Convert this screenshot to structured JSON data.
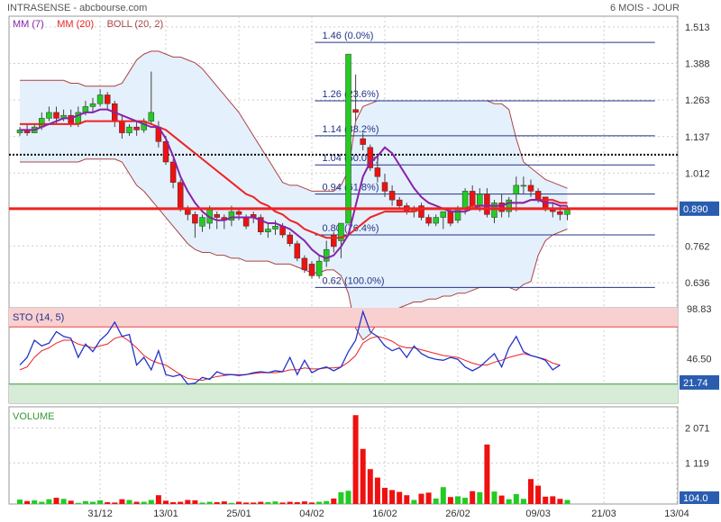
{
  "header": {
    "title": "INTRASENSE - abcbourse.com",
    "period": "6 MOIS - JOUR"
  },
  "colors": {
    "up": "#22cc22",
    "down": "#ee1111",
    "mm7": "#8822aa",
    "mm20": "#ee2222",
    "boll": "#aa4444",
    "boll_fill": "#e4f0fb",
    "fibo": "#223388",
    "sto_fast": "#2233cc",
    "sto_slow": "#ee2222",
    "price_tag": "#2a5db0"
  },
  "chart_data": [
    {
      "type": "candlestick",
      "title": "INTRASENSE",
      "legend": [
        {
          "label": "MM (7)",
          "color": "#8822aa"
        },
        {
          "label": "MM (20)",
          "color": "#ee2222"
        },
        {
          "label": "BOLL (20, 2)",
          "color": "#aa4444"
        }
      ],
      "x_labels": [
        "31/12",
        "13/01",
        "25/01",
        "04/02",
        "16/02",
        "26/02",
        "09/03",
        "21/03",
        "13/04"
      ],
      "x_label_index": [
        11,
        20,
        30,
        40,
        50,
        60,
        71,
        80,
        90
      ],
      "y_ticks": [
        1.513,
        1.388,
        1.263,
        1.137,
        1.012,
        0.762,
        0.636
      ],
      "ylim": [
        0.55,
        1.55
      ],
      "last_price": "0.890",
      "dotted_level": 1.075,
      "fibonacci": [
        {
          "label": "1.46  (0.0%)",
          "value": 1.46
        },
        {
          "label": "1.26  (23.6%)",
          "value": 1.26
        },
        {
          "label": "1.14  (38.2%)",
          "value": 1.14
        },
        {
          "label": "1.04  (50.0%)",
          "value": 1.04
        },
        {
          "label": "0.94  (61.8%)",
          "value": 0.94
        },
        {
          "label": "0.80  (76.4%)",
          "value": 0.8
        },
        {
          "label": "0.62  (100.0%)",
          "value": 0.62
        }
      ],
      "candles": [
        [
          1.15,
          1.17,
          1.14,
          1.16
        ],
        [
          1.16,
          1.18,
          1.14,
          1.15
        ],
        [
          1.15,
          1.18,
          1.15,
          1.17
        ],
        [
          1.17,
          1.22,
          1.16,
          1.2
        ],
        [
          1.2,
          1.24,
          1.19,
          1.22
        ],
        [
          1.22,
          1.24,
          1.18,
          1.2
        ],
        [
          1.2,
          1.23,
          1.19,
          1.21
        ],
        [
          1.21,
          1.23,
          1.17,
          1.18
        ],
        [
          1.18,
          1.24,
          1.17,
          1.22
        ],
        [
          1.22,
          1.26,
          1.21,
          1.24
        ],
        [
          1.24,
          1.27,
          1.22,
          1.25
        ],
        [
          1.25,
          1.3,
          1.24,
          1.28
        ],
        [
          1.28,
          1.29,
          1.23,
          1.25
        ],
        [
          1.25,
          1.26,
          1.17,
          1.19
        ],
        [
          1.19,
          1.21,
          1.13,
          1.15
        ],
        [
          1.15,
          1.18,
          1.14,
          1.17
        ],
        [
          1.17,
          1.19,
          1.14,
          1.16
        ],
        [
          1.16,
          1.2,
          1.15,
          1.19
        ],
        [
          1.19,
          1.36,
          1.18,
          1.22
        ],
        [
          1.17,
          1.19,
          1.1,
          1.12
        ],
        [
          1.12,
          1.14,
          1.04,
          1.05
        ],
        [
          1.05,
          1.06,
          0.96,
          0.98
        ],
        [
          0.98,
          0.99,
          0.88,
          0.89
        ],
        [
          0.89,
          0.9,
          0.85,
          0.87
        ],
        [
          0.87,
          0.88,
          0.79,
          0.84
        ],
        [
          0.83,
          0.87,
          0.81,
          0.86
        ],
        [
          0.84,
          0.9,
          0.82,
          0.89
        ],
        [
          0.87,
          0.88,
          0.82,
          0.86
        ],
        [
          0.86,
          0.87,
          0.82,
          0.85
        ],
        [
          0.85,
          0.9,
          0.83,
          0.88
        ],
        [
          0.88,
          0.89,
          0.85,
          0.87
        ],
        [
          0.86,
          0.87,
          0.82,
          0.83
        ],
        [
          0.87,
          0.88,
          0.84,
          0.86
        ],
        [
          0.86,
          0.87,
          0.8,
          0.81
        ],
        [
          0.81,
          0.84,
          0.79,
          0.82
        ],
        [
          0.82,
          0.85,
          0.8,
          0.83
        ],
        [
          0.83,
          0.84,
          0.79,
          0.8
        ],
        [
          0.8,
          0.81,
          0.76,
          0.77
        ],
        [
          0.77,
          0.78,
          0.71,
          0.72
        ],
        [
          0.72,
          0.73,
          0.67,
          0.68
        ],
        [
          0.7,
          0.71,
          0.65,
          0.66
        ],
        [
          0.66,
          0.73,
          0.65,
          0.71
        ],
        [
          0.71,
          0.78,
          0.69,
          0.75
        ],
        [
          0.8,
          0.81,
          0.74,
          0.76
        ],
        [
          0.78,
          0.84,
          0.72,
          0.84
        ],
        [
          0.84,
          1.42,
          0.84,
          1.42
        ],
        [
          1.23,
          1.35,
          1.19,
          1.22
        ],
        [
          1.13,
          1.15,
          1.09,
          1.11
        ],
        [
          1.1,
          1.11,
          1.02,
          1.03
        ],
        [
          1.03,
          1.07,
          0.98,
          1.0
        ],
        [
          0.98,
          1.01,
          0.93,
          0.95
        ],
        [
          0.95,
          0.97,
          0.9,
          0.92
        ],
        [
          0.92,
          0.93,
          0.89,
          0.9
        ],
        [
          0.9,
          0.91,
          0.87,
          0.88
        ],
        [
          0.88,
          0.9,
          0.86,
          0.89
        ],
        [
          0.9,
          0.91,
          0.85,
          0.86
        ],
        [
          0.86,
          0.87,
          0.83,
          0.84
        ],
        [
          0.84,
          0.87,
          0.83,
          0.86
        ],
        [
          0.86,
          0.88,
          0.82,
          0.88
        ],
        [
          0.88,
          0.89,
          0.83,
          0.84
        ],
        [
          0.85,
          0.9,
          0.84,
          0.89
        ],
        [
          0.89,
          0.96,
          0.87,
          0.95
        ],
        [
          0.95,
          0.97,
          0.89,
          0.9
        ],
        [
          0.9,
          0.96,
          0.88,
          0.94
        ],
        [
          0.94,
          0.96,
          0.86,
          0.87
        ],
        [
          0.86,
          0.92,
          0.84,
          0.91
        ],
        [
          0.91,
          0.94,
          0.86,
          0.88
        ],
        [
          0.88,
          0.93,
          0.86,
          0.92
        ],
        [
          0.94,
          1.0,
          0.88,
          0.97
        ],
        [
          0.97,
          1.0,
          0.94,
          0.97
        ],
        [
          0.97,
          0.99,
          0.93,
          0.95
        ],
        [
          0.95,
          0.96,
          0.91,
          0.92
        ],
        [
          0.93,
          0.93,
          0.88,
          0.89
        ],
        [
          0.89,
          0.91,
          0.86,
          0.88
        ],
        [
          0.88,
          0.9,
          0.85,
          0.87
        ],
        [
          0.87,
          0.9,
          0.85,
          0.89
        ]
      ],
      "mm7": [
        1.16,
        1.16,
        1.16,
        1.17,
        1.18,
        1.19,
        1.2,
        1.2,
        1.21,
        1.22,
        1.22,
        1.23,
        1.23,
        1.22,
        1.21,
        1.2,
        1.19,
        1.18,
        1.17,
        1.17,
        1.13,
        1.07,
        1.0,
        0.95,
        0.91,
        0.88,
        0.86,
        0.85,
        0.85,
        0.86,
        0.86,
        0.86,
        0.86,
        0.85,
        0.84,
        0.84,
        0.83,
        0.82,
        0.8,
        0.78,
        0.75,
        0.73,
        0.72,
        0.73,
        0.76,
        0.8,
        0.9,
        1.0,
        1.05,
        1.07,
        1.1,
        1.08,
        1.04,
        1.0,
        0.96,
        0.93,
        0.91,
        0.9,
        0.89,
        0.88,
        0.88,
        0.88,
        0.89,
        0.9,
        0.9,
        0.9,
        0.9,
        0.91,
        0.91,
        0.91,
        0.92,
        0.92,
        0.91,
        0.91,
        0.9,
        0.9
      ],
      "mm20": [
        1.18,
        1.18,
        1.18,
        1.18,
        1.18,
        1.18,
        1.18,
        1.18,
        1.18,
        1.19,
        1.19,
        1.19,
        1.19,
        1.19,
        1.19,
        1.19,
        1.19,
        1.19,
        1.18,
        1.17,
        1.16,
        1.14,
        1.12,
        1.1,
        1.08,
        1.06,
        1.04,
        1.02,
        1.0,
        0.98,
        0.96,
        0.94,
        0.93,
        0.91,
        0.9,
        0.88,
        0.87,
        0.85,
        0.84,
        0.82,
        0.81,
        0.8,
        0.79,
        0.79,
        0.79,
        0.8,
        0.82,
        0.84,
        0.86,
        0.87,
        0.88,
        0.88,
        0.88,
        0.88,
        0.88,
        0.89,
        0.89,
        0.89,
        0.89,
        0.89,
        0.89,
        0.89,
        0.9,
        0.9,
        0.9,
        0.9,
        0.9,
        0.91,
        0.91,
        0.91,
        0.92,
        0.92,
        0.92,
        0.92,
        0.91,
        0.91
      ],
      "boll_upper": [
        1.33,
        1.33,
        1.33,
        1.33,
        1.33,
        1.33,
        1.33,
        1.32,
        1.32,
        1.31,
        1.31,
        1.31,
        1.31,
        1.31,
        1.32,
        1.36,
        1.4,
        1.42,
        1.43,
        1.43,
        1.42,
        1.41,
        1.41,
        1.4,
        1.39,
        1.37,
        1.34,
        1.31,
        1.28,
        1.25,
        1.22,
        1.18,
        1.14,
        1.1,
        1.06,
        1.02,
        0.98,
        0.97,
        0.97,
        0.96,
        0.95,
        0.95,
        0.95,
        0.95,
        0.97,
        1.02,
        1.19,
        1.24,
        1.25,
        1.26,
        1.26,
        1.26,
        1.26,
        1.26,
        1.26,
        1.26,
        1.26,
        1.26,
        1.26,
        1.26,
        1.26,
        1.26,
        1.26,
        1.26,
        1.26,
        1.25,
        1.25,
        1.23,
        1.13,
        1.05,
        1.03,
        1.01,
        0.99,
        0.98,
        0.97,
        0.96
      ],
      "boll_lower": [
        1.05,
        1.05,
        1.05,
        1.05,
        1.05,
        1.05,
        1.05,
        1.05,
        1.05,
        1.06,
        1.06,
        1.06,
        1.06,
        1.06,
        1.05,
        1.01,
        0.97,
        0.95,
        0.92,
        0.89,
        0.86,
        0.83,
        0.8,
        0.77,
        0.75,
        0.74,
        0.74,
        0.73,
        0.73,
        0.72,
        0.72,
        0.71,
        0.71,
        0.71,
        0.71,
        0.7,
        0.7,
        0.7,
        0.69,
        0.68,
        0.67,
        0.67,
        0.68,
        0.68,
        0.66,
        0.6,
        0.48,
        0.44,
        0.46,
        0.5,
        0.52,
        0.54,
        0.55,
        0.56,
        0.57,
        0.57,
        0.58,
        0.58,
        0.59,
        0.59,
        0.6,
        0.6,
        0.61,
        0.62,
        0.62,
        0.62,
        0.62,
        0.62,
        0.61,
        0.63,
        0.64,
        0.73,
        0.78,
        0.8,
        0.81,
        0.82
      ]
    },
    {
      "type": "line",
      "title": "STO (14, 5)",
      "y_ticks": [
        98.83,
        46.5
      ],
      "ylim": [
        0,
        100
      ],
      "zone_upper": 80,
      "zone_lower": 20,
      "last_value": "21.74",
      "series": [
        {
          "values": [
            40,
            48,
            66,
            60,
            63,
            75,
            70,
            68,
            48,
            62,
            54,
            66,
            73,
            85,
            70,
            72,
            40,
            48,
            35,
            55,
            30,
            28,
            30,
            20,
            21,
            27,
            25,
            33,
            30,
            30,
            29,
            30,
            32,
            33,
            32,
            34,
            33,
            48,
            30,
            45,
            32,
            36,
            38,
            34,
            38,
            54,
            66,
            96,
            75,
            70,
            60,
            55,
            58,
            48,
            60,
            52,
            48,
            46,
            45,
            48,
            46,
            38,
            34,
            38,
            45,
            52,
            38,
            58,
            70,
            54,
            50,
            48,
            45,
            35,
            40
          ]
        },
        {
          "values": [
            35,
            38,
            48,
            55,
            58,
            63,
            66,
            66,
            62,
            60,
            58,
            60,
            62,
            68,
            70,
            65,
            58,
            50,
            45,
            42,
            40,
            35,
            30,
            26,
            25,
            24,
            26,
            28,
            29,
            30,
            30,
            30,
            31,
            32,
            32,
            32,
            33,
            35,
            35,
            37,
            36,
            36,
            37,
            37,
            38,
            43,
            50,
            63,
            68,
            70,
            68,
            65,
            60,
            58,
            58,
            56,
            54,
            52,
            50,
            49,
            48,
            45,
            42,
            40,
            40,
            43,
            45,
            48,
            50,
            52,
            50,
            48,
            46,
            42,
            40
          ]
        }
      ]
    },
    {
      "type": "bar",
      "title": "VOLUME",
      "y_ticks": [
        "2 071",
        "1 119"
      ],
      "ymax": 2500,
      "last_value": "104.0",
      "values": [
        120,
        80,
        100,
        60,
        130,
        170,
        140,
        90,
        30,
        80,
        60,
        100,
        50,
        40,
        130,
        110,
        60,
        60,
        110,
        240,
        90,
        50,
        60,
        110,
        100,
        40,
        60,
        50,
        70,
        30,
        60,
        40,
        40,
        60,
        50,
        70,
        40,
        60,
        50,
        70,
        40,
        60,
        80,
        150,
        320,
        360,
        2420,
        1500,
        950,
        720,
        440,
        380,
        330,
        240,
        110,
        280,
        310,
        150,
        460,
        190,
        210,
        170,
        350,
        320,
        1620,
        340,
        230,
        130,
        270,
        140,
        680,
        500,
        200,
        210,
        140,
        110
      ]
    }
  ]
}
